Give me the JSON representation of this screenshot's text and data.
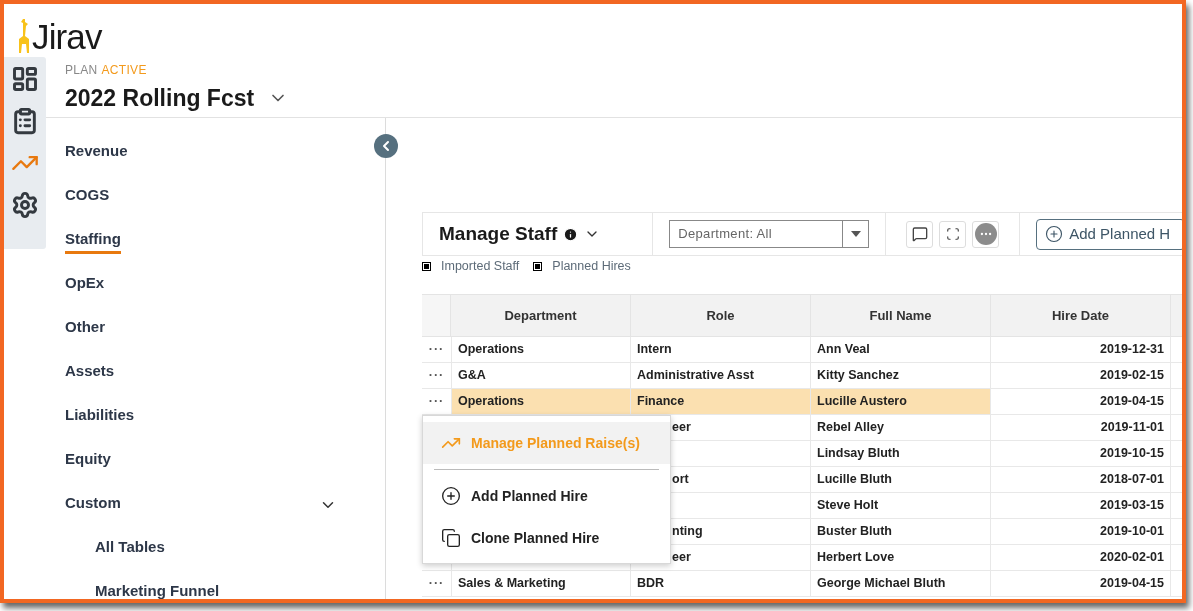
{
  "logo": {
    "text": "Jirav"
  },
  "rail": [
    {
      "selected": false
    },
    {
      "selected": false
    },
    {
      "selected": true
    },
    {
      "selected": false
    }
  ],
  "plan": {
    "label": "PLAN",
    "status": "ACTIVE",
    "title": "2022 Rolling Fcst"
  },
  "nav": [
    {
      "label": "Revenue",
      "selected": false
    },
    {
      "label": "COGS",
      "selected": false
    },
    {
      "label": "Staffing",
      "selected": true
    },
    {
      "label": "OpEx",
      "selected": false
    },
    {
      "label": "Other",
      "selected": false
    },
    {
      "label": "Assets",
      "selected": false
    },
    {
      "label": "Liabilities",
      "selected": false
    },
    {
      "label": "Equity",
      "selected": false
    },
    {
      "label": "Custom",
      "selected": false,
      "expanded": true,
      "children": [
        {
          "label": "All Tables",
          "selected": false
        },
        {
          "label": "Marketing Funnel",
          "selected": false
        }
      ]
    }
  ],
  "toolbar": {
    "title": "Manage Staff",
    "filter": "Department: All",
    "add_button": "Add Planned H"
  },
  "legend": [
    "Imported Staff",
    "Planned Hires"
  ],
  "table": {
    "columns": [
      "Department",
      "Role",
      "Full Name",
      "Hire Date"
    ],
    "rows": [
      {
        "menu": "···",
        "department": "Operations",
        "role": "Intern",
        "name": "Ann Veal",
        "hire_date": "2019-12-31",
        "selected": false
      },
      {
        "menu": "···",
        "department": "G&A",
        "role": "Administrative Asst",
        "name": "Kitty Sanchez",
        "hire_date": "2019-02-15",
        "selected": false
      },
      {
        "menu": "···",
        "department": "Operations",
        "role": "Finance",
        "name": "Lucille Austero",
        "hire_date": "2019-04-15",
        "selected": true
      },
      {
        "role": "eer",
        "role_cut": true,
        "name": "Rebel Alley",
        "hire_date": "2019-11-01",
        "selected": false
      },
      {
        "name": "Lindsay Bluth",
        "hire_date": "2019-10-15",
        "selected": false
      },
      {
        "role": "ort",
        "role_cut": true,
        "name": "Lucille Bluth",
        "hire_date": "2018-07-01",
        "selected": false
      },
      {
        "name": "Steve Holt",
        "hire_date": "2019-03-15",
        "selected": false
      },
      {
        "role": "nting",
        "role_cut": true,
        "name": "Buster Bluth",
        "hire_date": "2019-10-01",
        "selected": false
      },
      {
        "role": "eer",
        "role_cut": true,
        "name": "Herbert Love",
        "hire_date": "2020-02-01",
        "selected": false
      },
      {
        "menu": "···",
        "department": "Sales & Marketing",
        "role": "BDR",
        "name": "George Michael Bluth",
        "hire_date": "2019-04-15",
        "selected": false
      }
    ]
  },
  "context_menu": [
    {
      "kind": "raise",
      "label": "Manage Planned Raise(s)",
      "selected": true
    },
    {
      "kind": "add",
      "label": "Add Planned Hire",
      "selected": false
    },
    {
      "kind": "clone",
      "label": "Clone Planned Hire",
      "selected": false
    }
  ]
}
